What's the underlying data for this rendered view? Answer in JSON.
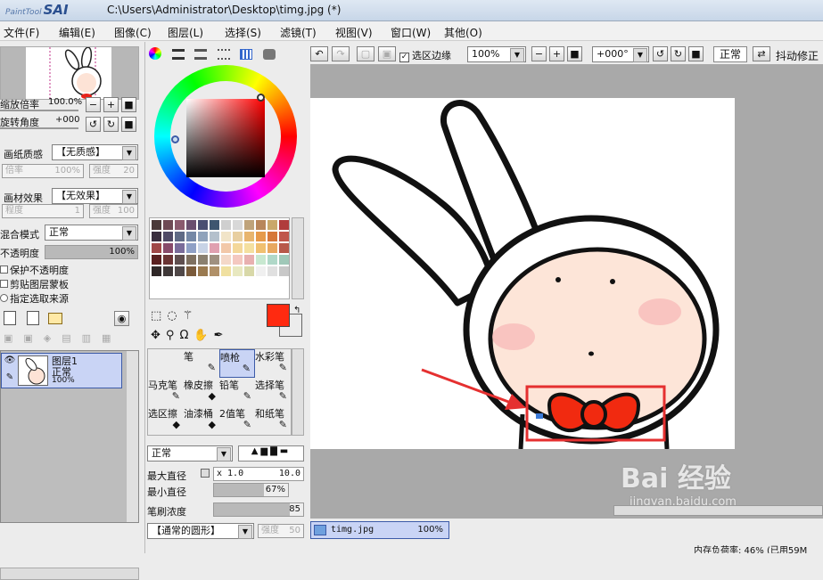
{
  "window": {
    "logo_small": "PaintTool",
    "logo_main": "SAI",
    "title": "C:\\Users\\Administrator\\Desktop\\timg.jpg (*)"
  },
  "menu": [
    "文件(F)",
    "编辑(E)",
    "图像(C)",
    "图层(L)",
    "选择(S)",
    "滤镜(T)",
    "视图(V)",
    "窗口(W)",
    "其他(O)"
  ],
  "navigator": {
    "zoom_label": "缩放倍率",
    "zoom_value": "100.0%",
    "rotate_label": "旋转角度",
    "rotate_value": "+000"
  },
  "paper": {
    "texture_label": "画纸质感",
    "texture_value": "【无质感】",
    "scale_label": "倍率",
    "scale_value": "100%",
    "strength_label": "强度",
    "strength_value": "20",
    "effect_label": "画材效果",
    "effect_value": "【无效果】",
    "degree_label": "程度",
    "degree_value": "1",
    "strength2_label": "强度",
    "strength2_value": "100"
  },
  "layer_props": {
    "blend_label": "混合模式",
    "blend_value": "正常",
    "opacity_label": "不透明度",
    "opacity_value": "100%",
    "opacity_fraction": 1.0,
    "options": [
      "保护不透明度",
      "剪贴图层蒙板",
      "指定选取来源"
    ]
  },
  "layer": {
    "name": "图层1",
    "mode": "正常",
    "opacity": "100%"
  },
  "colors": {
    "primary": "#ff2a10",
    "secondary": "#ffffff",
    "accent": "#3c5ba8",
    "selection": "#c9d4f5",
    "palette": [
      "#4b3a3a",
      "#6e4a55",
      "#8a5a6e",
      "#6a4f6f",
      "#4a4f72",
      "#3e5670",
      "#cfcfcf",
      "#d8d8d8",
      "#bfa37a",
      "#b8865a",
      "#c9a86a",
      "#b03c3c",
      "#3a2f3f",
      "#4f4a66",
      "#5f6a85",
      "#7588a6",
      "#8fa2bb",
      "#b4c0cc",
      "#f1e4c8",
      "#e8cfa0",
      "#e8b56e",
      "#e69a4a",
      "#d6783a",
      "#c0564a",
      "#a04848",
      "#884a6a",
      "#7a6c9a",
      "#8fa0c6",
      "#c8d3e6",
      "#e0a0b0",
      "#f2c8a8",
      "#f4d89a",
      "#f4e0a0",
      "#f0c070",
      "#e8a860",
      "#b8584a",
      "#5a2020",
      "#6a3434",
      "#5f4f4f",
      "#7e7060",
      "#8a8070",
      "#9f9080",
      "#f4d8c8",
      "#f4c8c0",
      "#e8b0b0",
      "#c8e8d0",
      "#b0d8c8",
      "#a0c8b8",
      "#302828",
      "#3f3838",
      "#504848",
      "#7a5a3a",
      "#9a7a50",
      "#b09068",
      "#f0e0a0",
      "#e8e8c0",
      "#d8d8a8",
      "#f0f0f0",
      "#e0e0e0",
      "#c8c8c8"
    ]
  },
  "tools": {
    "brushes": [
      "笔",
      "喷枪",
      "水彩笔",
      "马克笔",
      "橡皮擦",
      "铅笔",
      "选择笔",
      "选区擦",
      "油漆桶",
      "2值笔",
      "和纸笔"
    ],
    "mode_value": "正常",
    "max_size_label": "最大直径",
    "max_size_mult": "x 1.0",
    "max_size_value": "10.0",
    "min_size_label": "最小直径",
    "min_size_value": "67%",
    "min_size_fraction": 0.67,
    "density_label": "笔刷浓度",
    "density_value": "85",
    "density_fraction": 0.85,
    "shape_value": "【通常的圆形】",
    "shape_strength_label": "强度",
    "shape_strength_value": "50"
  },
  "canvas_toolbar": {
    "selection_edge_label": "选区边缘",
    "zoom_value": "100%",
    "angle_value": "+000°",
    "blend_value": "正常",
    "stabilizer_label": "抖动修正"
  },
  "document_tab": {
    "name": "timg.jpg",
    "zoom": "100%"
  },
  "status": {
    "memory": "内存负荷率: 46% (已用59M"
  },
  "watermark": {
    "brand": "Bai 经验",
    "url": "jingyan.baidu.com"
  }
}
